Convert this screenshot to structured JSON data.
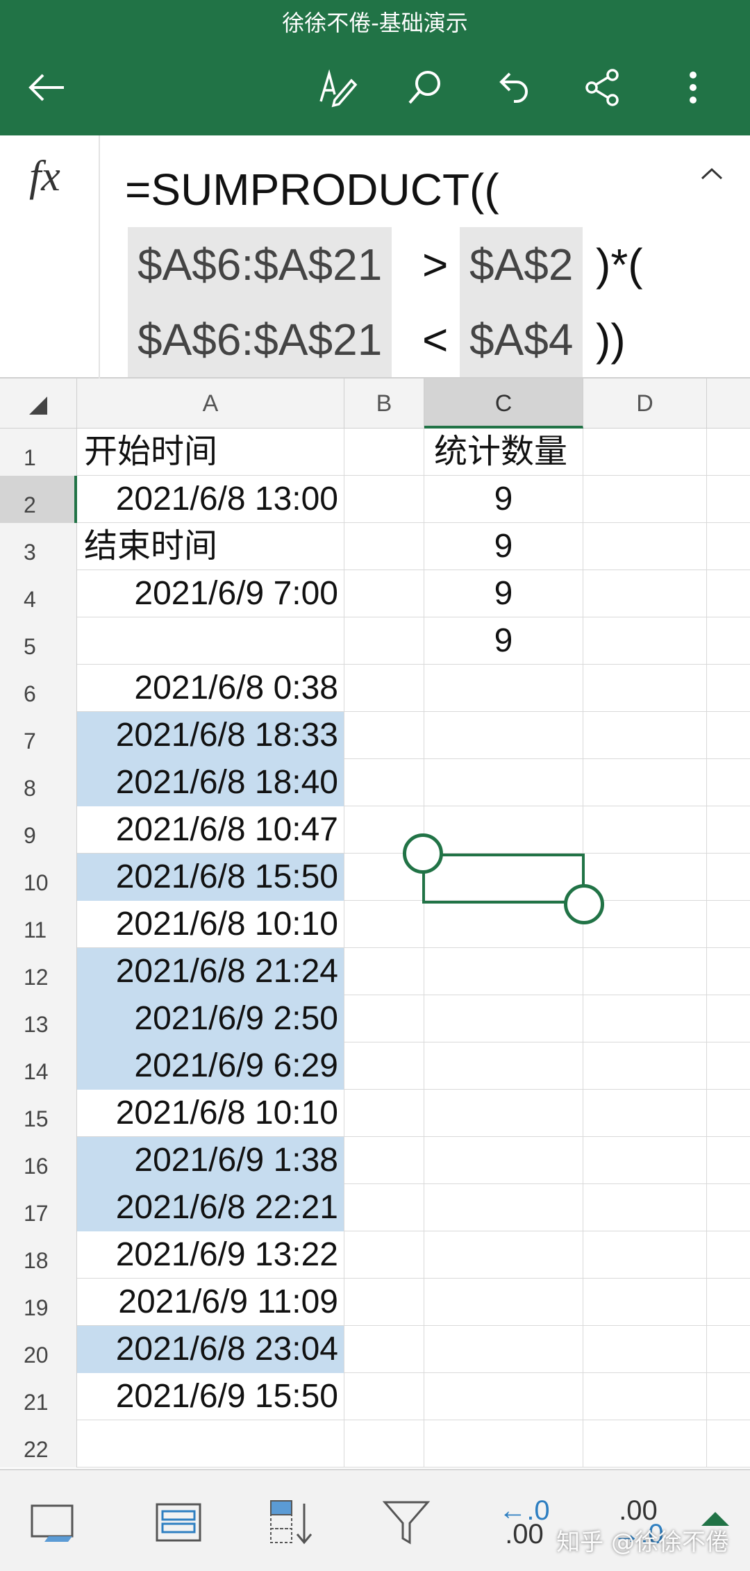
{
  "header": {
    "title": "徐徐不倦-基础演示",
    "bg_color": "#217346",
    "buttons": [
      "back-arrow-icon",
      "edit-pen-icon",
      "search-icon",
      "undo-icon",
      "share-icon",
      "more-vertical-icon"
    ]
  },
  "formula_bar": {
    "fx_label": "fx",
    "line1": "=SUMPRODUCT((",
    "ref1": "$A$6:$A$21",
    "op1": ">",
    "ref2": "$A$2",
    "tail1": ")*(",
    "ref3": "$A$6:$A$21",
    "op2": "<",
    "ref4": "$A$4",
    "tail2": "))"
  },
  "grid": {
    "columns": [
      "A",
      "B",
      "C",
      "D"
    ],
    "selected_column": "C",
    "selected_row": "2",
    "rows": [
      {
        "n": "1",
        "a": "开始时间",
        "a_text": true,
        "c": "统计数量",
        "c_text": true,
        "hl": false
      },
      {
        "n": "2",
        "a": "2021/6/8 13:00",
        "c": "9",
        "hl": false
      },
      {
        "n": "3",
        "a": "结束时间",
        "a_text": true,
        "c": "9",
        "hl": false
      },
      {
        "n": "4",
        "a": "2021/6/9 7:00",
        "c": "9",
        "hl": false
      },
      {
        "n": "5",
        "a": "",
        "c": "9",
        "hl": false
      },
      {
        "n": "6",
        "a": "2021/6/8 0:38",
        "c": "",
        "hl": false
      },
      {
        "n": "7",
        "a": "2021/6/8 18:33",
        "c": "",
        "hl": true
      },
      {
        "n": "8",
        "a": "2021/6/8 18:40",
        "c": "",
        "hl": true
      },
      {
        "n": "9",
        "a": "2021/6/8 10:47",
        "c": "",
        "hl": false
      },
      {
        "n": "10",
        "a": "2021/6/8 15:50",
        "c": "",
        "hl": true
      },
      {
        "n": "11",
        "a": "2021/6/8 10:10",
        "c": "",
        "hl": false
      },
      {
        "n": "12",
        "a": "2021/6/8 21:24",
        "c": "",
        "hl": true
      },
      {
        "n": "13",
        "a": "2021/6/9 2:50",
        "c": "",
        "hl": true
      },
      {
        "n": "14",
        "a": "2021/6/9 6:29",
        "c": "",
        "hl": true
      },
      {
        "n": "15",
        "a": "2021/6/8 10:10",
        "c": "",
        "hl": false
      },
      {
        "n": "16",
        "a": "2021/6/9 1:38",
        "c": "",
        "hl": true
      },
      {
        "n": "17",
        "a": "2021/6/8 22:21",
        "c": "",
        "hl": true
      },
      {
        "n": "18",
        "a": "2021/6/9 13:22",
        "c": "",
        "hl": false
      },
      {
        "n": "19",
        "a": "2021/6/9 11:09",
        "c": "",
        "hl": false
      },
      {
        "n": "20",
        "a": "2021/6/8 23:04",
        "c": "",
        "hl": true
      },
      {
        "n": "21",
        "a": "2021/6/9 15:50",
        "c": "",
        "hl": false
      },
      {
        "n": "22",
        "a": "",
        "c": "",
        "hl": false
      }
    ],
    "highlight_color": "#c6dcef"
  },
  "toolbar": {
    "buttons": [
      "freeze-panes-icon",
      "format-cells-icon",
      "sort-icon",
      "filter-icon",
      "decrease-decimal-icon",
      "increase-decimal-icon"
    ],
    "decrease_decimal_top": "←.0",
    "decrease_decimal_bottom": ".00",
    "increase_decimal_top": ".00",
    "increase_decimal_bottom": "→.0",
    "watermark": "知乎 @徐徐不倦"
  }
}
